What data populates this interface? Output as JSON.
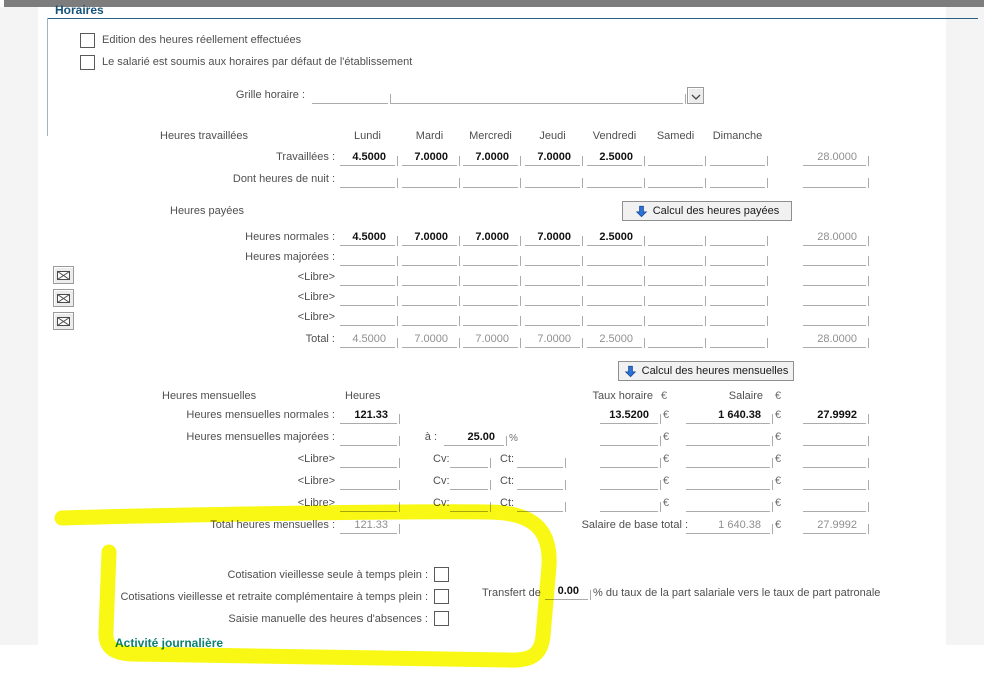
{
  "page": {
    "section_title": "Horaires",
    "activity_title": "Activité journalière"
  },
  "top_checkboxes": [
    {
      "label": "Edition des heures réellement effectuées",
      "checked": false
    },
    {
      "label": "Le salarié est soumis aux horaires par défaut de l'établissement",
      "checked": false
    }
  ],
  "grille_horaire": {
    "label": "Grille horaire :",
    "code": "",
    "name": ""
  },
  "days": [
    "Lundi",
    "Mardi",
    "Mercredi",
    "Jeudi",
    "Vendredi",
    "Samedi",
    "Dimanche"
  ],
  "heures_travaillees": {
    "title": "Heures travaillées",
    "rows": [
      {
        "label": "Travaillées :",
        "values": [
          "4.5000",
          "7.0000",
          "7.0000",
          "7.0000",
          "2.5000",
          "",
          ""
        ],
        "total": "28.0000",
        "muted": false
      },
      {
        "label": "Dont heures de nuit :",
        "values": [
          "",
          "",
          "",
          "",
          "",
          "",
          ""
        ],
        "total": "",
        "muted": false
      }
    ]
  },
  "heures_payees": {
    "title": "Heures payées",
    "button_label": "Calcul des heures payées",
    "rows": [
      {
        "label": "Heures normales :",
        "values": [
          "4.5000",
          "7.0000",
          "7.0000",
          "7.0000",
          "2.5000",
          "",
          ""
        ],
        "total": "28.0000",
        "muted": false
      },
      {
        "label": "Heures majorées :",
        "values": [
          "",
          "",
          "",
          "",
          "",
          "",
          ""
        ],
        "total": "",
        "muted": false
      },
      {
        "label": "<Libre>",
        "values": [
          "",
          "",
          "",
          "",
          "",
          "",
          ""
        ],
        "total": "",
        "muted": false
      },
      {
        "label": "<Libre>",
        "values": [
          "",
          "",
          "",
          "",
          "",
          "",
          ""
        ],
        "total": "",
        "muted": false
      },
      {
        "label": "<Libre>",
        "values": [
          "",
          "",
          "",
          "",
          "",
          "",
          ""
        ],
        "total": "",
        "muted": false
      },
      {
        "label": "Total :",
        "values": [
          "4.5000",
          "7.0000",
          "7.0000",
          "7.0000",
          "2.5000",
          "",
          ""
        ],
        "total": "28.0000",
        "muted": true
      }
    ]
  },
  "heures_mensuelles": {
    "title": "Heures mensuelles",
    "button_label": "Calcul des heures mensuelles",
    "headers": {
      "heures": "Heures",
      "taux": "Taux horaire",
      "salaire": "Salaire",
      "euro": "€"
    },
    "rows": {
      "normales": {
        "label": "Heures mensuelles normales :",
        "heures": "121.33",
        "taux": "13.5200",
        "salaire": "1 640.38",
        "coef": "27.9992"
      },
      "majorees": {
        "label": "Heures mensuelles majorées :",
        "heures": "",
        "a_label": "à :",
        "majoration": "25.00",
        "percent": "%",
        "taux": "",
        "salaire": "",
        "coef": ""
      },
      "libre1": {
        "label": "<Libre>",
        "heures": "",
        "cv_label": "Cv:",
        "cv": "",
        "ct_label": "Ct:",
        "ct": "",
        "taux": "",
        "salaire": "",
        "coef": ""
      },
      "libre2": {
        "label": "<Libre>",
        "heures": "",
        "cv_label": "Cv:",
        "cv": "",
        "ct_label": "Ct:",
        "ct": "",
        "taux": "",
        "salaire": "",
        "coef": ""
      },
      "libre3": {
        "label": "<Libre>",
        "heures": "",
        "cv_label": "Cv:",
        "cv": "",
        "ct_label": "Ct:",
        "ct": "",
        "taux": "",
        "salaire": "",
        "coef": ""
      }
    },
    "total": {
      "label": "Total heures mensuelles :",
      "heures": "121.33",
      "salaire_label": "Salaire de base total :",
      "salaire": "1 640.38",
      "coef": "27.9992"
    },
    "euro": "€"
  },
  "bottom": {
    "checkbox_rows": [
      {
        "label": "Cotisation vieillesse seule à temps plein :",
        "checked": false
      },
      {
        "label": "Cotisations vieillesse et retraite complémentaire à temps plein :",
        "checked": false
      },
      {
        "label": "Saisie manuelle des heures d'absences :",
        "checked": false
      }
    ],
    "transfert_label": "Transfert de",
    "transfert_value": "0.00",
    "transfert_suffix": "% du taux de la part salariale vers le taux de part patronale"
  },
  "icons": {
    "calc_arrow": "blue-down-arrow",
    "dropdown": "chevron-down",
    "libre_buttons": "envelope"
  },
  "colors": {
    "section_blue": "#14537c",
    "section_teal": "#0d8070",
    "highlight_yellow": "#f7f700",
    "arrow_blue": "#2b74d9"
  }
}
